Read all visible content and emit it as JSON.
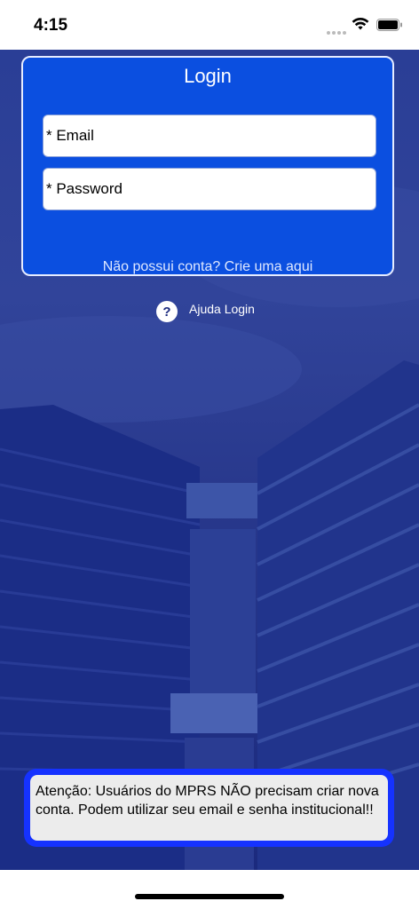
{
  "status_bar": {
    "time": "4:15"
  },
  "login": {
    "title": "Login",
    "email_placeholder": "* Email",
    "password_placeholder": "* Password",
    "signup_link": "Não possui conta? Crie uma aqui"
  },
  "help": {
    "icon_glyph": "?",
    "label": "Ajuda Login"
  },
  "notice": {
    "text": "Atenção: Usuários do MPRS NÃO precisam criar nova conta. Podem utilizar seu email e senha institucional!!"
  },
  "colors": {
    "card_blue": "#0b4fe0",
    "background_tint": "#2a3e96",
    "notice_border": "#1532ff",
    "notice_bg": "#ececec"
  },
  "icons": [
    "wifi-icon",
    "battery-icon",
    "help-icon"
  ]
}
